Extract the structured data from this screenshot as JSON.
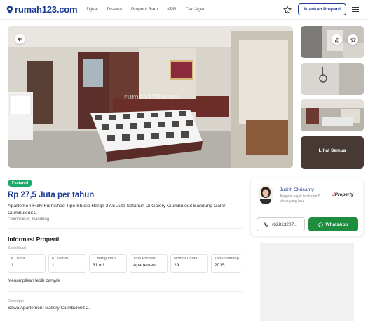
{
  "header": {
    "logo_text": "rumah123.com",
    "nav": [
      "Dijual",
      "Disewa",
      "Properti Baru",
      "KPR",
      "Cari Agen"
    ],
    "cta_label": "Iklankan Properti"
  },
  "gallery": {
    "watermark": "rumah123.com",
    "see_all_label": "Lihat Semua"
  },
  "listing": {
    "badge": "Featured",
    "price": "Rp 27,5 Juta per tahun",
    "title": "Apartemen Fully Furnished Tipe Studio Harga 27.5 Juta Setahun Di Galery Ciumbuleuit Bandung Galeri Ciumbuleuit 2",
    "location": "Ciumbuleuit, Bandung"
  },
  "info": {
    "section_title": "Informasi Properti",
    "spec_label": "Spesifikasi",
    "specs": [
      {
        "key": "K. Tidur",
        "value": "1"
      },
      {
        "key": "K. Mandi",
        "value": "1"
      },
      {
        "key": "L. Bangunan",
        "value": "31 m²"
      },
      {
        "key": "Tipe Properti",
        "value": "Apartemen"
      },
      {
        "key": "Nomor Lantai",
        "value": "29"
      },
      {
        "key": "Tahun dibang",
        "value": "2015"
      }
    ],
    "more_label": "Menampilkan lebih banyak",
    "desc_label": "Deskripsi",
    "desc_text": "Sewa Apartement Gallery Ciumbuleuit 2."
  },
  "agent": {
    "name": "Judith Chrisanty",
    "subtitle": "Anggota sejak lebih dari 5 tahun yang lalu",
    "agency_prefix": "J",
    "agency_rest": "Property",
    "phone": "+62813207...",
    "whatsapp_label": "WhatsApp"
  },
  "colors": {
    "brand": "#1f3a93",
    "featured": "#1fa86b",
    "whatsapp": "#1e8e3e"
  }
}
